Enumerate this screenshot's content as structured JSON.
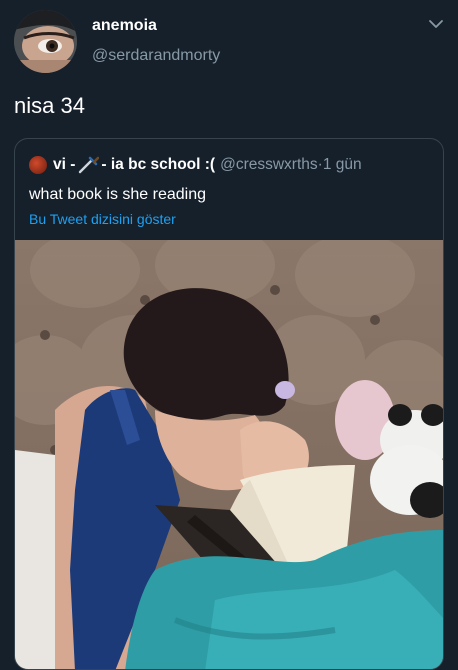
{
  "author": {
    "name": "anemoia",
    "handle": "@serdarandmorty"
  },
  "tweet": {
    "text": "nisa 34"
  },
  "quoted_tweet": {
    "name_prefix": "vi - ",
    "name_suffix": " - ia bc school :(",
    "handle": "@cresswxrths",
    "separator": " · ",
    "time": "1 gün",
    "text": "what book is she reading",
    "thread_link": "Bu Tweet dizisini göster"
  },
  "icons": {
    "more": "chevron-down-icon",
    "quoted_emoji": "dagger-icon"
  },
  "colors": {
    "background": "#15202b",
    "secondary_text": "#8899a6",
    "link": "#1da1f2",
    "border": "#38444d"
  }
}
